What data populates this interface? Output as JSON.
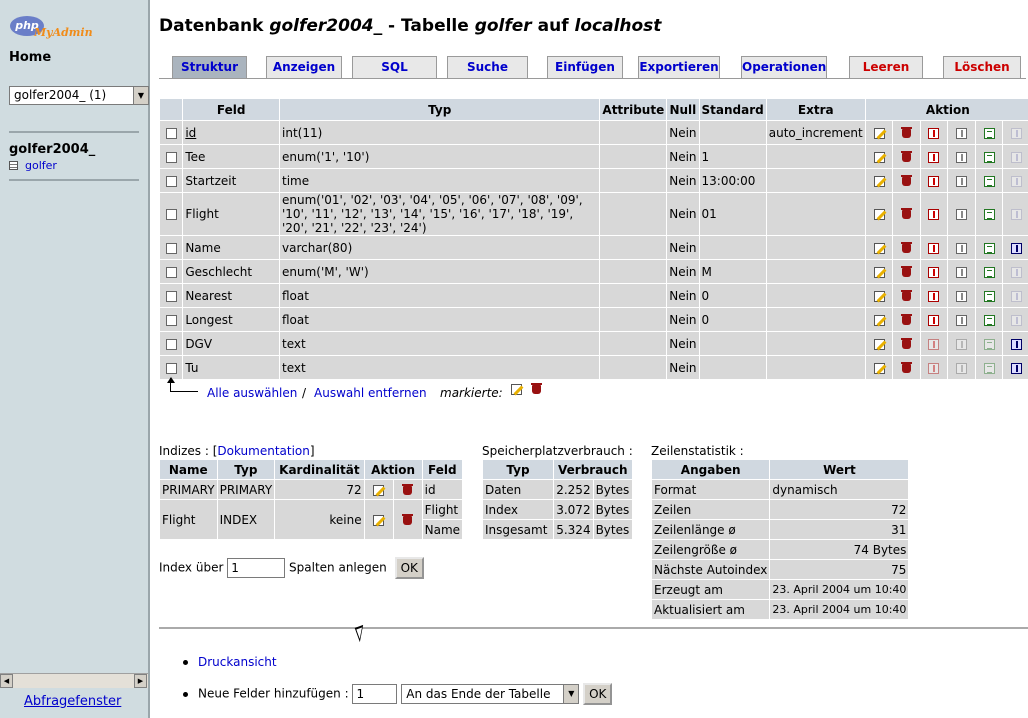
{
  "app": {
    "logo_main": "php",
    "logo_sub": "MyAdmin"
  },
  "left": {
    "home_label": "Home",
    "db_select_value": "golfer2004_ (1)",
    "db_name": "golfer2004_",
    "table_name": "golfer",
    "query_window_label": "Abfragefenster"
  },
  "header": {
    "prefix": "Datenbank ",
    "db": "golfer2004_",
    "middle": " - Tabelle ",
    "table": "golfer",
    "middle2": " auf ",
    "host": "localhost"
  },
  "tabs": [
    {
      "label": "Struktur",
      "active": true
    },
    {
      "label": "Anzeigen"
    },
    {
      "label": "SQL"
    },
    {
      "label": "Suche"
    },
    {
      "label": "Einfügen"
    },
    {
      "label": "Exportieren"
    },
    {
      "label": "Operationen"
    },
    {
      "label": "Leeren",
      "danger": true
    },
    {
      "label": "Löschen",
      "danger": true
    }
  ],
  "fields_table": {
    "headers": {
      "field": "Feld",
      "type": "Typ",
      "attributes": "Attribute",
      "null": "Null",
      "default": "Standard",
      "extra": "Extra",
      "action": "Aktion"
    },
    "rows": [
      {
        "name": "id",
        "type": "int(11)",
        "attr": "",
        "null": "Nein",
        "default": "",
        "extra": "auto_increment",
        "key_disabled": false,
        "ft": false
      },
      {
        "name": "Tee",
        "type": "enum('1', '10')",
        "attr": "",
        "null": "Nein",
        "default": "1",
        "extra": "",
        "key_disabled": false,
        "ft": false
      },
      {
        "name": "Startzeit",
        "type": "time",
        "attr": "",
        "null": "Nein",
        "default": "13:00:00",
        "extra": "",
        "key_disabled": false,
        "ft": false
      },
      {
        "name": "Flight",
        "type": "enum('01', '02', '03', '04', '05', '06', '07', '08', '09', '10', '11', '12', '13', '14', '15', '16', '17', '18', '19', '20', '21', '22', '23', '24')",
        "attr": "",
        "null": "Nein",
        "default": "01",
        "extra": "",
        "key_disabled": false,
        "ft": false
      },
      {
        "name": "Name",
        "type": "varchar(80)",
        "attr": "",
        "null": "Nein",
        "default": "",
        "extra": "",
        "key_disabled": false,
        "ft": true
      },
      {
        "name": "Geschlecht",
        "type": "enum('M', 'W')",
        "attr": "",
        "null": "Nein",
        "default": "M",
        "extra": "",
        "key_disabled": false,
        "ft": false
      },
      {
        "name": "Nearest",
        "type": "float",
        "attr": "",
        "null": "Nein",
        "default": "0",
        "extra": "",
        "key_disabled": false,
        "ft": false
      },
      {
        "name": "Longest",
        "type": "float",
        "attr": "",
        "null": "Nein",
        "default": "0",
        "extra": "",
        "key_disabled": false,
        "ft": false
      },
      {
        "name": "DGV",
        "type": "text",
        "attr": "",
        "null": "Nein",
        "default": "",
        "extra": "",
        "key_disabled": true,
        "ft": true
      },
      {
        "name": "Tu",
        "type": "text",
        "attr": "",
        "null": "Nein",
        "default": "",
        "extra": "",
        "key_disabled": true,
        "ft": true
      }
    ]
  },
  "selection": {
    "select_all": "Alle auswählen",
    "separator": "/",
    "select_none": "Auswahl entfernen",
    "marked": "markierte:"
  },
  "indexes": {
    "caption_prefix": "Indizes : [",
    "caption_link": "Dokumentation",
    "caption_suffix": "]",
    "headers": {
      "name": "Name",
      "type": "Typ",
      "cardinality": "Kardinalität",
      "action": "Aktion",
      "field": "Feld"
    },
    "rows": [
      {
        "name": "PRIMARY",
        "type": "PRIMARY",
        "cardinality": "72",
        "fields": [
          "id"
        ]
      },
      {
        "name": "Flight",
        "type": "INDEX",
        "cardinality": "keine",
        "fields": [
          "Flight",
          "Name"
        ]
      }
    ],
    "form_prefix": "Index über",
    "form_value": "1",
    "form_suffix": "Spalten anlegen",
    "ok_label": "OK"
  },
  "space": {
    "caption": "Speicherplatzverbrauch :",
    "headers": {
      "type": "Typ",
      "usage": "Verbrauch"
    },
    "rows": [
      {
        "type": "Daten",
        "value": "2.252",
        "unit": "Bytes"
      },
      {
        "type": "Index",
        "value": "3.072",
        "unit": "Bytes"
      },
      {
        "type": "Insgesamt",
        "value": "5.324",
        "unit": "Bytes"
      }
    ]
  },
  "stats": {
    "caption": "Zeilenstatistik :",
    "headers": {
      "label": "Angaben",
      "value": "Wert"
    },
    "rows": [
      {
        "label": "Format",
        "value": "dynamisch",
        "align": "left"
      },
      {
        "label": "Zeilen",
        "value": "72",
        "align": "right"
      },
      {
        "label": "Zeilenlänge ø",
        "value": "31",
        "align": "right"
      },
      {
        "label": "Zeilengröße ø",
        "value": "74 Bytes",
        "align": "right"
      },
      {
        "label": "Nächste Autoindex",
        "value": "75",
        "align": "right"
      },
      {
        "label": "Erzeugt am",
        "value": "23. April 2004 um 10:40",
        "align": "right",
        "small": true
      },
      {
        "label": "Aktualisiert am",
        "value": "23. April 2004 um 10:40",
        "align": "right",
        "small": true
      }
    ]
  },
  "bottom": {
    "print_view": "Druckansicht",
    "add_fields_label": "Neue Felder hinzufügen :",
    "add_fields_value": "1",
    "position_select": "An das Ende der Tabelle",
    "ok_label": "OK"
  }
}
